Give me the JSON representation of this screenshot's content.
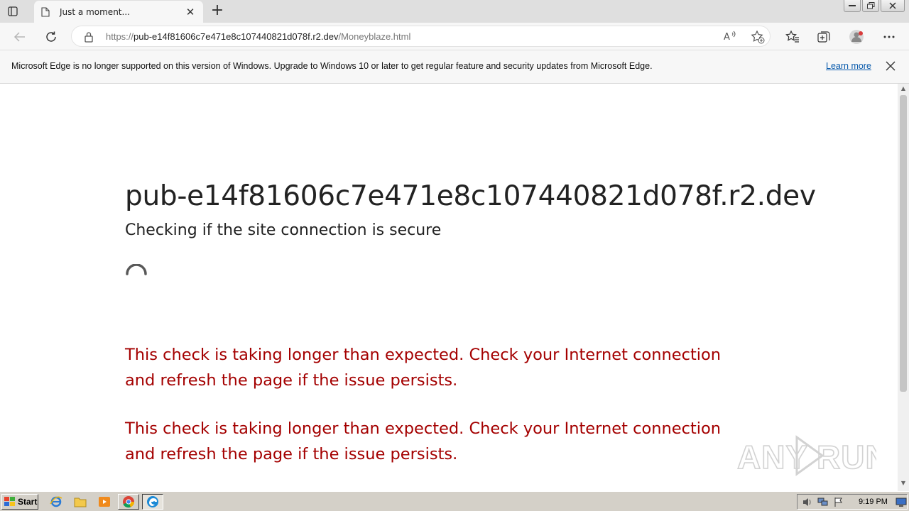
{
  "tab": {
    "title": "Just a moment..."
  },
  "address": {
    "scheme": "https://",
    "host": "pub-e14f81606c7e471e8c107440821d078f.r2.dev",
    "path": "/Moneyblaze.html"
  },
  "infobar": {
    "message": "Microsoft Edge is no longer supported on this version of Windows. Upgrade to Windows 10 or later to get regular feature and security updates from Microsoft Edge.",
    "link": "Learn more"
  },
  "page": {
    "heading": "pub-e14f81606c7e471e8c107440821d078f.r2.dev",
    "subheading": "Checking if the site connection is secure",
    "warning_1": "This check is taking longer than expected. Check your Internet connection and refresh the page if the issue persists.",
    "warning_2": "This check is taking longer than expected. Check your Internet connection and refresh the page if the issue persists."
  },
  "watermark": "ANY RUN",
  "taskbar": {
    "start_label": "Start",
    "clock": "9:19 PM"
  },
  "colors": {
    "warning_text": "#a40000",
    "link": "#0b5cad",
    "accent_edge": "#1b8ad6"
  },
  "icons": [
    "tab-actions-icon",
    "page-icon",
    "close-icon",
    "new-tab-icon",
    "back-icon",
    "refresh-icon",
    "lock-icon",
    "read-aloud-icon",
    "add-favorite-icon",
    "favorites-icon",
    "collections-icon",
    "profile-icon",
    "more-icon",
    "spinner-icon",
    "ie-icon",
    "explorer-icon",
    "media-player-icon",
    "chrome-icon",
    "edge-icon",
    "volume-icon",
    "network-icon",
    "flag-icon",
    "desktop-icon"
  ]
}
